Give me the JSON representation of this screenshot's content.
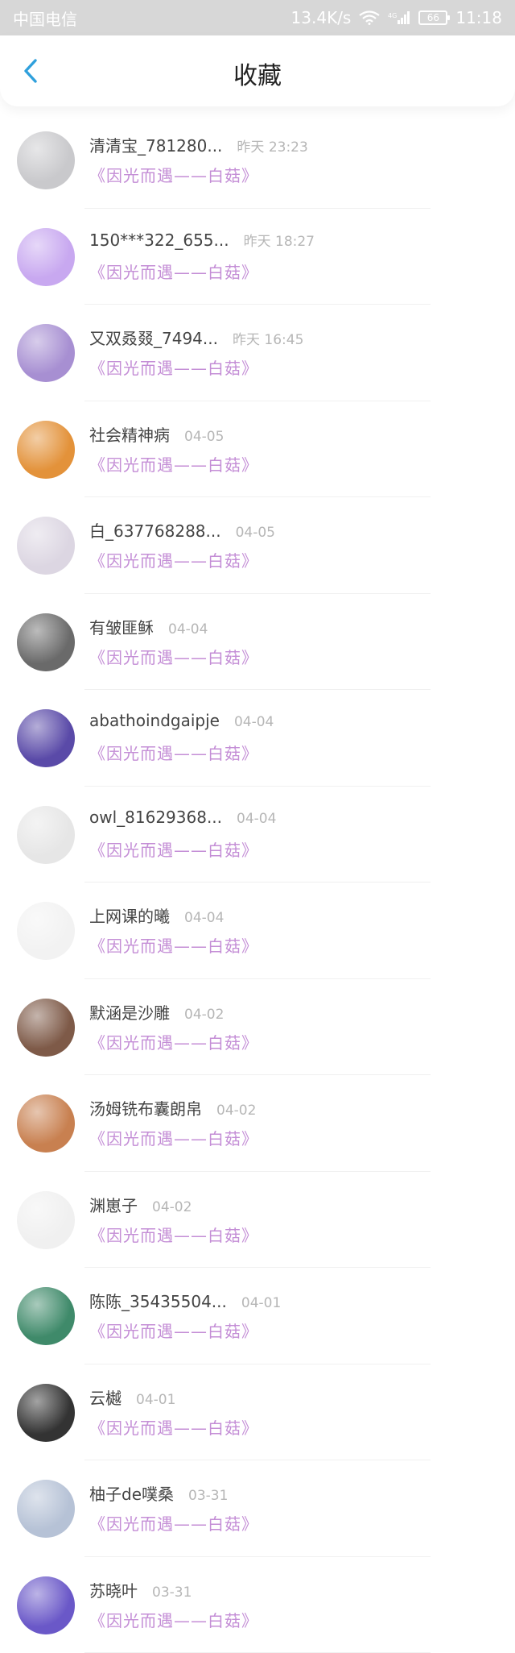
{
  "status_bar": {
    "carrier": "中国电信",
    "speed": "13.4K/s",
    "network": "4G",
    "battery": "66",
    "time": "11:18"
  },
  "header": {
    "title": "收藏"
  },
  "items": [
    {
      "user": "清清宝_781280...",
      "time": "昨天 23:23",
      "title": "《因光而遇——白菇》",
      "avatar_color": "#c9c9cc"
    },
    {
      "user": "150***322_655...",
      "time": "昨天 18:27",
      "title": "《因光而遇——白菇》",
      "avatar_color": "#c8a8f0"
    },
    {
      "user": "又双叒叕_7494...",
      "time": "昨天 16:45",
      "title": "《因光而遇——白菇》",
      "avatar_color": "#a78fd2"
    },
    {
      "user": "社会精神病",
      "time": "04-05",
      "title": "《因光而遇——白菇》",
      "avatar_color": "#e3923a"
    },
    {
      "user": "白_637768288...",
      "time": "04-05",
      "title": "《因光而遇——白菇》",
      "avatar_color": "#dcd6e2"
    },
    {
      "user": "有皱匪稣",
      "time": "04-04",
      "title": "《因光而遇——白菇》",
      "avatar_color": "#6a6a6a"
    },
    {
      "user": "abathoindgaipje",
      "time": "04-04",
      "title": "《因光而遇——白菇》",
      "avatar_color": "#5a4aa8"
    },
    {
      "user": "owl_81629368...",
      "time": "04-04",
      "title": "《因光而遇——白菇》",
      "avatar_color": "#e6e6e6"
    },
    {
      "user": "上网课的曦",
      "time": "04-04",
      "title": "《因光而遇——白菇》",
      "avatar_color": "#f2f2f2"
    },
    {
      "user": "默涵是沙雕",
      "time": "04-02",
      "title": "《因光而遇——白菇》",
      "avatar_color": "#7e5a48"
    },
    {
      "user": "汤姆铣布囊朗帛",
      "time": "04-02",
      "title": "《因光而遇——白菇》",
      "avatar_color": "#c88050"
    },
    {
      "user": "渊崽子",
      "time": "04-02",
      "title": "《因光而遇——白菇》",
      "avatar_color": "#f0f0f0"
    },
    {
      "user": "陈陈_35435504...",
      "time": "04-01",
      "title": "《因光而遇——白菇》",
      "avatar_color": "#3f8a6a"
    },
    {
      "user": "云樾",
      "time": "04-01",
      "title": "《因光而遇——白菇》",
      "avatar_color": "#333333"
    },
    {
      "user": "柚子de噗桑",
      "time": "03-31",
      "title": "《因光而遇——白菇》",
      "avatar_color": "#b6c2d6"
    },
    {
      "user": "苏晓叶",
      "time": "03-31",
      "title": "《因光而遇——白菇》",
      "avatar_color": "#6a58c8"
    }
  ],
  "accent": "#c48ed6",
  "back_color": "#2fa0dc"
}
